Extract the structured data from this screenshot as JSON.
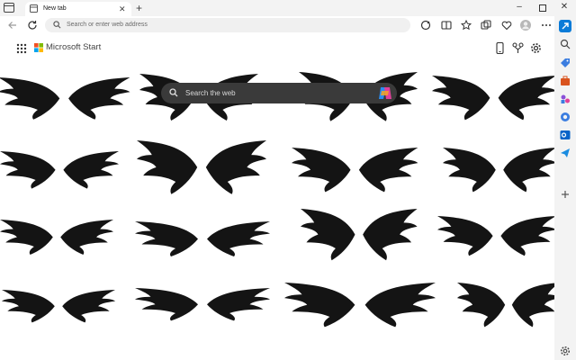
{
  "browser": {
    "tab": {
      "title": "New tab"
    },
    "address_bar": {
      "placeholder": "Search or enter web address"
    }
  },
  "page": {
    "brand": "Microsoft Start",
    "search": {
      "placeholder": "Search the web"
    },
    "wallpaper": {
      "subject": "black wing silhouettes",
      "rows": 4,
      "columns": 5
    }
  },
  "icons": {
    "tabstrip": [
      "tab-actions-icon",
      "new-tab-favicon",
      "close-icon",
      "plus-icon",
      "minimize-icon",
      "maximize-icon",
      "close-window-icon"
    ],
    "toolbar": [
      "back-arrow-icon",
      "refresh-icon",
      "search-icon",
      "copilot-extension-icon",
      "split-screen-icon",
      "favorites-icon",
      "collections-icon",
      "browser-essentials-icon",
      "profile-avatar-icon",
      "more-options-icon"
    ],
    "page_header": [
      "app-launcher-icon",
      "microsoft-logo-icon",
      "phone-icon",
      "rewards-trophy-icon",
      "settings-icon"
    ],
    "sidebar": [
      "copilot-icon",
      "search-icon",
      "tag-icon",
      "toolbox-icon",
      "games-icon",
      "microsoft365-icon",
      "outlook-icon",
      "send-icon",
      "add-icon",
      "sidebar-settings-icon"
    ]
  },
  "colors": {
    "chrome_background": "#f3f3f3",
    "search_box": "#3a3a3a",
    "copilot_blue": "#0a7bd8"
  }
}
